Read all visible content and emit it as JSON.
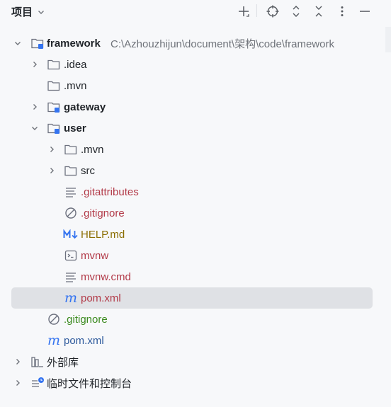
{
  "panel": {
    "title": "项目"
  },
  "toolbar": {
    "icons": [
      "add-icon",
      "locate-icon",
      "expand-all-icon",
      "collapse-all-icon",
      "more-icon",
      "minimize-icon"
    ]
  },
  "tree": {
    "root": {
      "label": "framework",
      "path": "C:\\Azhouzhijun\\document\\架构\\code\\framework"
    },
    "idea": {
      "label": ".idea"
    },
    "mvn": {
      "label": ".mvn"
    },
    "gateway": {
      "label": "gateway"
    },
    "user": {
      "label": "user"
    },
    "user_mvn": {
      "label": ".mvn"
    },
    "user_src": {
      "label": "src"
    },
    "user_gitattributes": {
      "label": ".gitattributes"
    },
    "user_gitignore": {
      "label": ".gitignore"
    },
    "user_help": {
      "label": "HELP.md"
    },
    "user_mvnw": {
      "label": "mvnw"
    },
    "user_mvnw_cmd": {
      "label": "mvnw.cmd"
    },
    "user_pom": {
      "label": "pom.xml"
    },
    "gitignore": {
      "label": ".gitignore"
    },
    "pom": {
      "label": "pom.xml"
    },
    "external_libs": {
      "label": "外部库"
    },
    "scratches": {
      "label": "临时文件和控制台"
    }
  },
  "colors": {
    "modified": "#b23a48",
    "added": "#3b8a1f",
    "markdown": "#8a6d00",
    "maven": "#2e5a9c",
    "selection": "#dfe1e5"
  }
}
